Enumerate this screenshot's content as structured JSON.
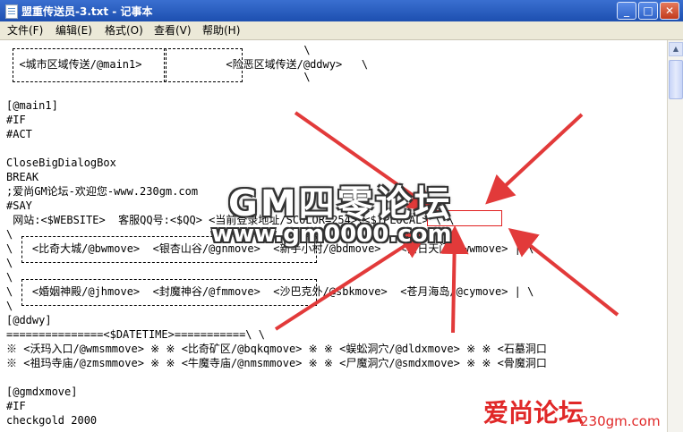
{
  "window": {
    "title": "盟重传送员-3.txt - 记事本"
  },
  "window_controls": {
    "minimize": "_",
    "maximize": "□",
    "close": "✕"
  },
  "menu": [
    "文件(F)",
    "编辑(E)",
    "格式(O)",
    "查看(V)",
    "帮助(H)"
  ],
  "scrollbar": {
    "up": "▲"
  },
  "lines": [
    "                                              \\",
    "  <城市区域传送/@main1>             <险恶区域传送/@ddwy>   \\",
    "                                              \\",
    "",
    "[@main1]",
    "#IF",
    "#ACT",
    "",
    "CloseBigDialogBox",
    "BREAK",
    ";爱尚GM论坛-欢迎您-www.230gm.com",
    "#SAY",
    " 网站:<$WEBSITE>  客服QQ号:<$QQ> <当前登录地址/SCOLOR=254>:<$IPLOCAL> \\ \\",
    "\\",
    "\\   <比奇大城/@bwmove>  <银杏山谷/@gnmove>  <新手小村/@bdmove>   <白日天门/@wwmove> | \\",
    "\\",
    "\\",
    "\\   <婚姻神殿/@jhmove>  <封魔神谷/@fmmove>  <沙巴克外/@sbkmove>  <苍月海岛/@cymove> | \\",
    "\\",
    "[@ddwy]",
    "===============<$DATETIME>===========\\ \\",
    "※ <沃玛入口/@wmsmmove> ※ ※ <比奇矿区/@bqkqmove> ※ ※ <蜈蚣洞穴/@dldxmove> ※ ※ <石墓洞口",
    "※ <祖玛寺庙/@zmsmmove> ※ ※ <牛魔寺庙/@nmsmmove> ※ ※ <尸魔洞穴/@smdxmove> ※ ※ <骨魔洞口",
    "",
    "[@gmdxmove]",
    "#IF",
    "checkgold 2000"
  ],
  "watermarks": {
    "main": "GM四零论坛",
    "url": "www.gm0000.com",
    "brand": "爱尚论坛",
    "brand_url": "230gm.com"
  }
}
